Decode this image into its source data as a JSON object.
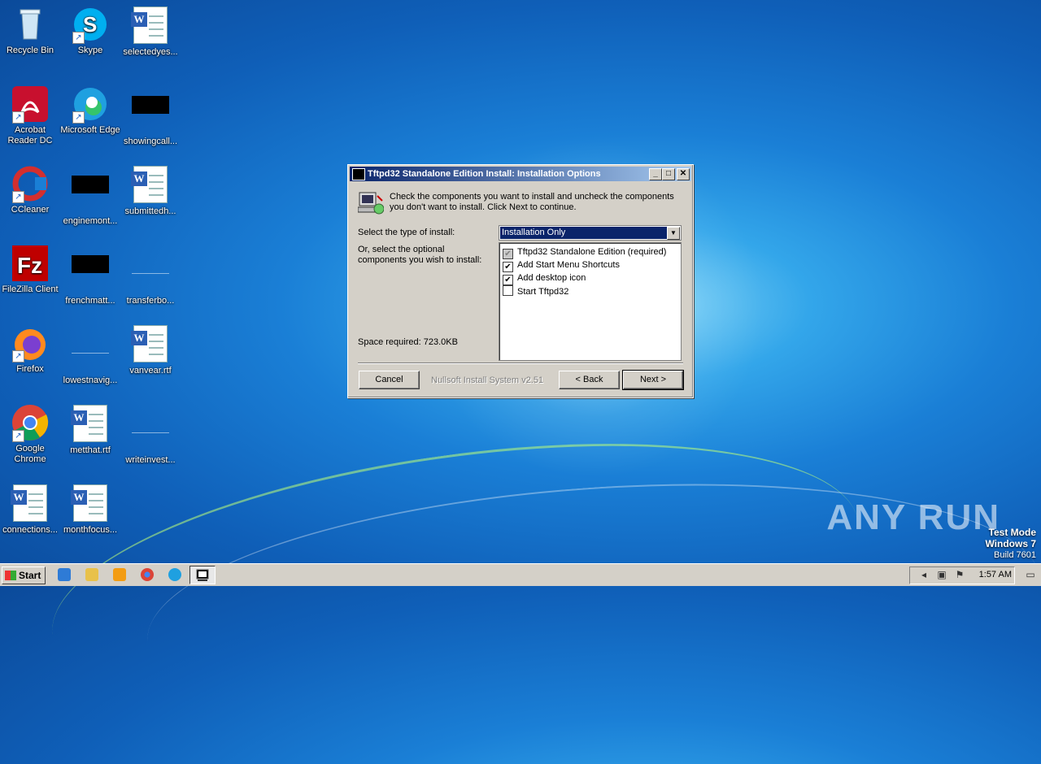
{
  "desktop": {
    "icons": [
      {
        "label": "Recycle Bin"
      },
      {
        "label": "Skype"
      },
      {
        "label": "selectedyes..."
      },
      {
        "label": "Acrobat Reader DC"
      },
      {
        "label": "Microsoft Edge"
      },
      {
        "label": "showingcall..."
      },
      {
        "label": "CCleaner"
      },
      {
        "label": "enginemont..."
      },
      {
        "label": "submittedh..."
      },
      {
        "label": "FileZilla Client"
      },
      {
        "label": "frenchmatt..."
      },
      {
        "label": "transferbo..."
      },
      {
        "label": "Firefox"
      },
      {
        "label": "lowestnavig..."
      },
      {
        "label": "vanvear.rtf"
      },
      {
        "label": "Google Chrome"
      },
      {
        "label": "metthat.rtf"
      },
      {
        "label": "writeinvest..."
      },
      {
        "label": "connections..."
      },
      {
        "label": "monthfocus..."
      }
    ]
  },
  "dialog": {
    "title": "Tftpd32 Standalone Edition Install: Installation Options",
    "header_text": "Check the components you want to install and uncheck the components you don't want to install. Click Next to continue.",
    "install_type_label": "Select the type of install:",
    "install_type_value": "Installation Only",
    "optional_label": "Or, select the optional components you wish to install:",
    "components": [
      {
        "label": "Tftpd32 Standalone Edition (required)",
        "checked": true,
        "disabled": true
      },
      {
        "label": "Add Start Menu Shortcuts",
        "checked": true,
        "disabled": false
      },
      {
        "label": "Add desktop icon",
        "checked": true,
        "disabled": false
      },
      {
        "label": "Start Tftpd32",
        "checked": false,
        "disabled": false
      }
    ],
    "space_required": "Space required: 723.0KB",
    "branding": "Nullsoft Install System v2.51",
    "cancel_label": "Cancel",
    "back_label": "< Back",
    "next_label": "Next >"
  },
  "watermark": {
    "text": "ANY RUN",
    "test_mode": "Test Mode",
    "os": "Windows 7",
    "build": "Build 7601"
  },
  "taskbar": {
    "start_label": "Start",
    "clock": "1:57 AM"
  }
}
